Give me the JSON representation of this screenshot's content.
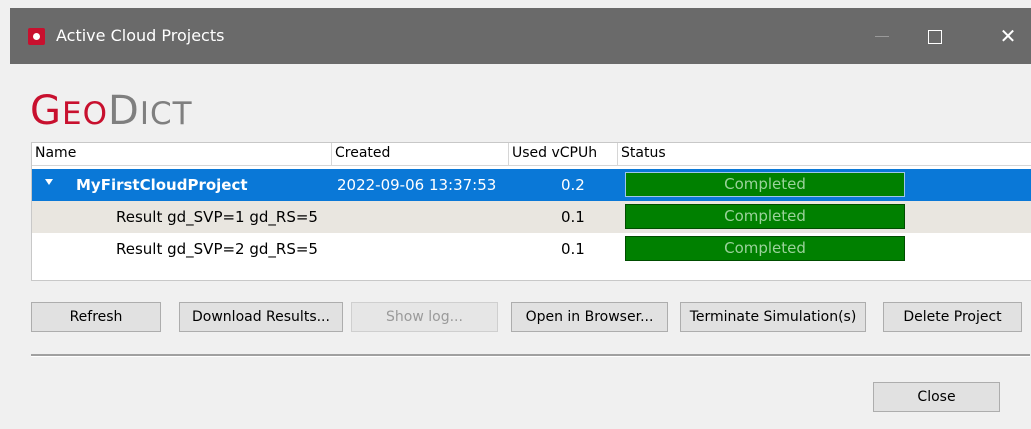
{
  "window": {
    "title": "Active Cloud Projects"
  },
  "logo": {
    "g": "G",
    "eo": "EO",
    "d": "D",
    "ict": "ICT"
  },
  "table": {
    "headers": {
      "name": "Name",
      "created": "Created",
      "used": "Used vCPUh",
      "status": "Status"
    },
    "rows": [
      {
        "name": "MyFirstCloudProject",
        "created": "2022-09-06 13:37:53",
        "used": "0.2",
        "status": "Completed",
        "progress": 1.0
      },
      {
        "name": "Result gd_SVP=1 gd_RS=5",
        "created": "",
        "used": "0.1",
        "status": "Completed",
        "progress": 1.0
      },
      {
        "name": "Result gd_SVP=2 gd_RS=5",
        "created": "",
        "used": "0.1",
        "status": "Completed",
        "progress": 1.0
      }
    ]
  },
  "buttons": {
    "refresh": "Refresh",
    "download": "Download Results...",
    "show_log": "Show log...",
    "open_browser": "Open in Browser...",
    "terminate": "Terminate Simulation(s)",
    "delete": "Delete Project",
    "close": "Close"
  },
  "colors": {
    "brand": "#c8102e",
    "selection": "#0a78d7",
    "progress": "#008000"
  }
}
